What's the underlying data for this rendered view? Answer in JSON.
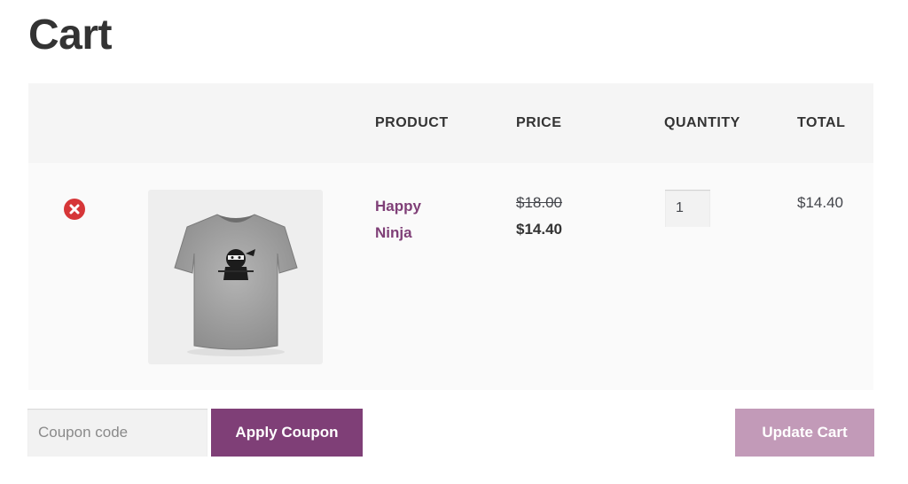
{
  "page": {
    "title": "Cart"
  },
  "table": {
    "headers": {
      "product": "PRODUCT",
      "price": "PRICE",
      "quantity": "QUANTITY",
      "total": "TOTAL"
    },
    "items": [
      {
        "product_name": "Happy Ninja",
        "price_regular": "$18.00",
        "price_sale": "$14.40",
        "quantity": "1",
        "line_total": "$14.40",
        "thumbnail_icon": "ninja-tshirt-icon"
      }
    ]
  },
  "actions": {
    "coupon_placeholder": "Coupon code",
    "apply_coupon_label": "Apply Coupon",
    "update_cart_label": "Update Cart"
  },
  "colors": {
    "brand_purple": "#7f3f77",
    "update_disabled": "#c29ab8",
    "remove_red": "#d63638",
    "header_bg": "#f5f5f5",
    "row_bg": "#fafafa"
  }
}
